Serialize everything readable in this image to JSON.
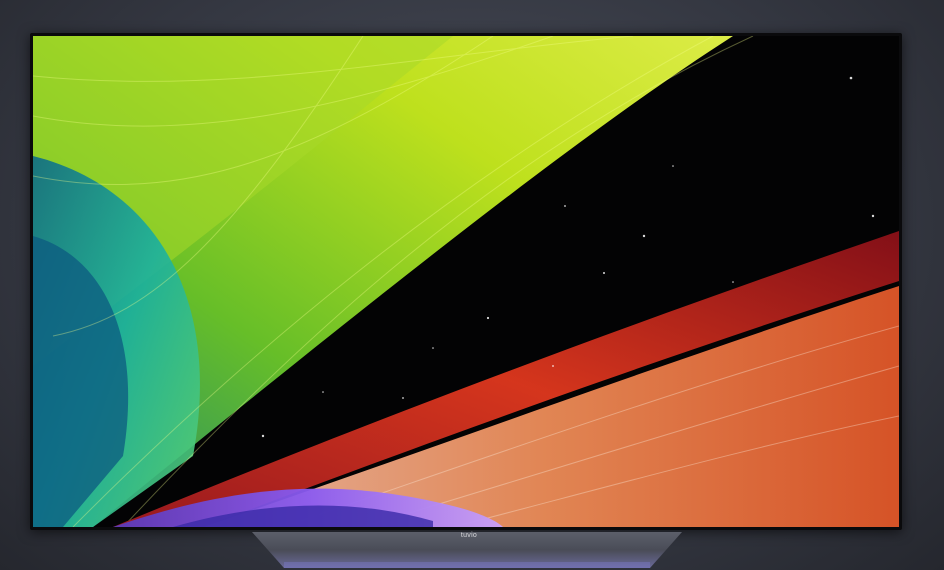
{
  "tv": {
    "brand": "tuvio"
  },
  "icons": {
    "screen": "abstract-light-streaks-wallpaper",
    "stand": "tv-stand-base"
  },
  "colors": {
    "background": "#3a3d47",
    "bezel": "#0a0a0c",
    "green_streak": "#b8e21a",
    "teal_streak": "#1aa6a0",
    "red_streak": "#d8321e",
    "orange_streak": "#f0824a",
    "purple_streak": "#7a4ae0"
  }
}
